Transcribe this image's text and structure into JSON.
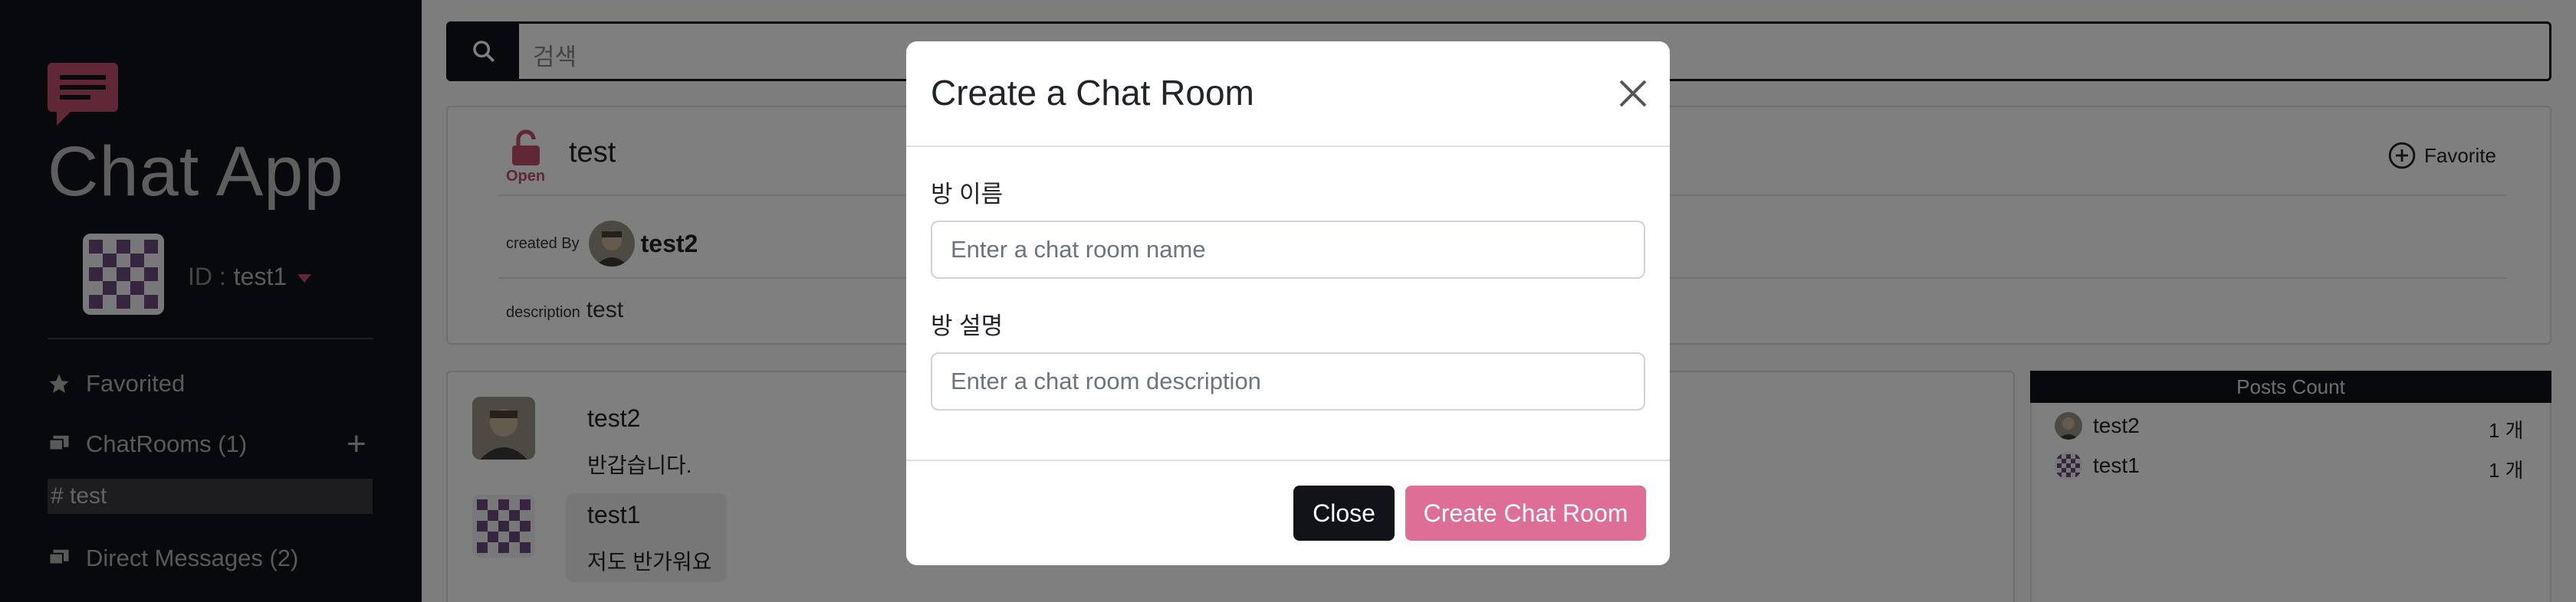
{
  "app": {
    "title": "Chat App",
    "brand_color": "#c0506f",
    "accent_color": "#de6e96"
  },
  "search": {
    "placeholder": "검색"
  },
  "user": {
    "id_label": "ID :",
    "id_value": "test1"
  },
  "sidebar": {
    "favorited_label": "Favorited",
    "chatrooms_label": "ChatRooms (1)",
    "rooms": [
      {
        "label": "# test"
      }
    ],
    "direct_messages_label": "Direct Messages (2)"
  },
  "room": {
    "lock_label": "Open",
    "name": "test",
    "favorite_label": "Favorite",
    "created_by_label": "created By",
    "creator": "test2",
    "description_label": "description",
    "description": "test"
  },
  "messages": [
    {
      "name": "test2",
      "text": "반갑습니다."
    },
    {
      "name": "test1",
      "text": "저도 반가워요"
    }
  ],
  "posts": {
    "title": "Posts Count",
    "rows": [
      {
        "name": "test2",
        "count": "1 개"
      },
      {
        "name": "test1",
        "count": "1 개"
      }
    ]
  },
  "modal": {
    "title": "Create a Chat Room",
    "name_label": "방 이름",
    "name_placeholder": "Enter a chat room name",
    "description_label": "방 설명",
    "description_placeholder": "Enter a chat room description",
    "close_label": "Close",
    "create_label": "Create Chat Room"
  }
}
